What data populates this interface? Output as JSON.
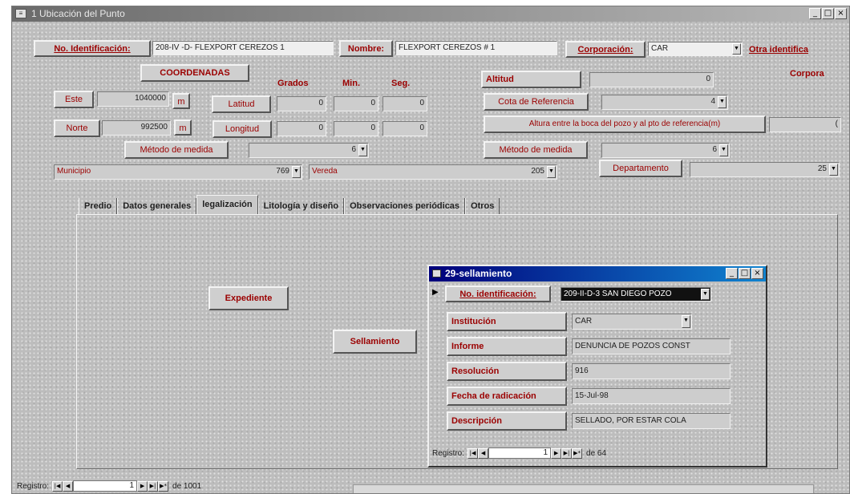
{
  "window": {
    "title": "1 Ubicación del Punto",
    "min": "_",
    "max": "□",
    "close": "×"
  },
  "header": {
    "no_id_label": "No. Identificación:",
    "no_id_value": "208-IV -D- FLEXPORT CEREZOS 1",
    "nombre_label": "Nombre:",
    "nombre_value": "FLEXPORT CEREZOS # 1",
    "corporacion_label": "Corporación:",
    "corporacion_value": "CAR",
    "otra_label": "Otra identifica",
    "corpora_label": "Corpora"
  },
  "coords": {
    "title": "COORDENADAS",
    "grados": "Grados",
    "min": "Min.",
    "seg": "Seg.",
    "este_label": "Este",
    "este_value": "1040000",
    "m1": "m",
    "norte_label": "Norte",
    "norte_value": "992500",
    "m2": "m",
    "latitud_label": "Latitud",
    "lat_g": "0",
    "lat_m": "0",
    "lat_s": "0",
    "longitud_label": "Longitud",
    "lon_g": "0",
    "lon_m": "0",
    "lon_s": "0",
    "metodo_label": "Método de medida",
    "metodo_value": "6"
  },
  "right": {
    "altitud_label": "Altitud",
    "altitud_value": "0",
    "cota_label": "Cota de Referencia",
    "cota_value": "4",
    "altura_label": "Altura entre la boca del pozo y al pto de referencia(m)",
    "altura_value": "(",
    "metodo_label": "Método de medida",
    "metodo_value": "6",
    "depto_label": "Departamento",
    "depto_value": "25"
  },
  "location": {
    "municipio_label": "Municipio",
    "municipio_value": "769",
    "vereda_label": "Vereda",
    "vereda_value": "205"
  },
  "tabs": [
    "Predio",
    "Datos generales",
    "legalización",
    "Litología y diseño",
    "Observaciones periódicas",
    "Otros"
  ],
  "panel": {
    "expediente": "Expediente",
    "sellamiento": "Sellamiento"
  },
  "subform": {
    "title": "29-sellamiento",
    "record_marker": "▶",
    "no_id_label": "No. identificación:",
    "no_id_value": "209-II-D-3 SAN DIEGO POZO",
    "institucion_label": "Institución",
    "institucion_value": "CAR",
    "informe_label": "Informe",
    "informe_value": "DENUNCIA DE POZOS CONST",
    "resolucion_label": "Resolución",
    "resolucion_value": "916",
    "fecha_label": "Fecha de radicación",
    "fecha_value": "15-Jul-98",
    "descripcion_label": "Descripción",
    "descripcion_value": "SELLADO, POR ESTAR COLA",
    "nav_label": "Registro:",
    "nav_current": "1",
    "nav_of": "de 64"
  },
  "mainnav": {
    "label": "Registro:",
    "current": "1",
    "of": "de 1001"
  },
  "colors": {
    "label_red": "#9b0000",
    "form_bg": "#bdbdbd",
    "subtitle_blue": "#00007b"
  }
}
